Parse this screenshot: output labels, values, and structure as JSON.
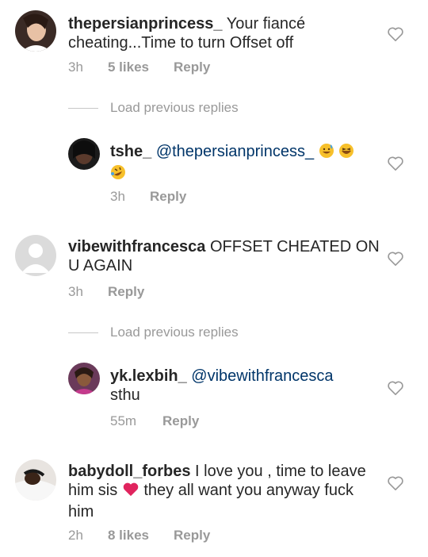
{
  "comments": [
    {
      "username": "thepersianprincess_",
      "text": "Your fiancé cheating...Time to turn Offset off",
      "time": "3h",
      "likes": "5 likes",
      "reply_label": "Reply"
    },
    {
      "username": "tshe_",
      "mention": "@thepersianprincess_",
      "emoji": [
        "grinning-sweat-icon",
        "laughing-icon",
        "rolling-laughing-icon"
      ],
      "time": "3h",
      "reply_label": "Reply"
    },
    {
      "username": "vibewithfrancesca",
      "text": "OFFSET CHEATED ON U AGAIN",
      "time": "3h",
      "reply_label": "Reply"
    },
    {
      "username": "yk.lexbih_",
      "mention": "@vibewithfrancesca",
      "text": "sthu",
      "time": "55m",
      "reply_label": "Reply"
    },
    {
      "username": "babydoll_forbes",
      "text_before_heart": "I love you , time to leave him sis",
      "text_after_heart": "they all want you anyway fuck him",
      "time": "2h",
      "likes": "8 likes",
      "reply_label": "Reply"
    }
  ],
  "load_previous": [
    "Load previous replies",
    "Load previous replies"
  ],
  "colors": {
    "text": "#262626",
    "meta": "#999999",
    "mention": "#003569",
    "heart_emoji": "#e0245e"
  }
}
